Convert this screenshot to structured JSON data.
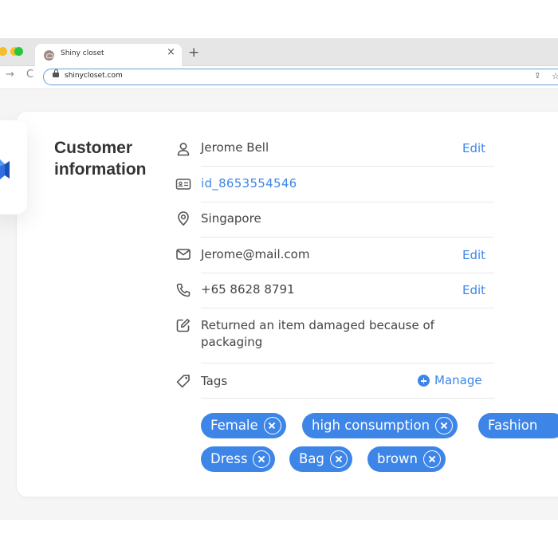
{
  "browser": {
    "tab_title": "Shiny closet",
    "tab_close": "×",
    "new_tab": "+",
    "url": "shinycloset.com",
    "back_glyph": "→",
    "reload_glyph": "C",
    "share_glyph": "⇪",
    "bookmark_glyph": "☆",
    "window_controls": [
      {
        "name": "close",
        "color": "#f4bf2a"
      },
      {
        "name": "minimize",
        "color": "#f4bf2a"
      },
      {
        "name": "zoom",
        "color": "#29c440"
      }
    ]
  },
  "customer": {
    "heading": "Customer information",
    "name": "Jerome Bell",
    "customer_id": "id_8653554546",
    "location": "Singapore",
    "email": "Jerome@mail.com",
    "phone": "+65 8628 8791",
    "note": "Returned an item damaged because of packaging",
    "edit_label": "Edit",
    "tags_label": "Tags",
    "manage_label": "Manage",
    "tags": [
      "Female",
      "high consumption",
      "Fashion",
      "Dress",
      "Bag",
      "brown"
    ]
  },
  "icons": {
    "person": "user-icon",
    "id": "id-card-icon",
    "location": "location-pin-icon",
    "email": "mail-icon",
    "phone": "phone-icon",
    "note": "edit-note-icon",
    "tag": "tag-icon",
    "manage": "plus-circle-icon",
    "chip_remove": "close-circle-icon"
  },
  "colors": {
    "accent": "#3d86e8",
    "text": "#444444",
    "heading": "#333333",
    "page_background": "#f5f5f6"
  }
}
